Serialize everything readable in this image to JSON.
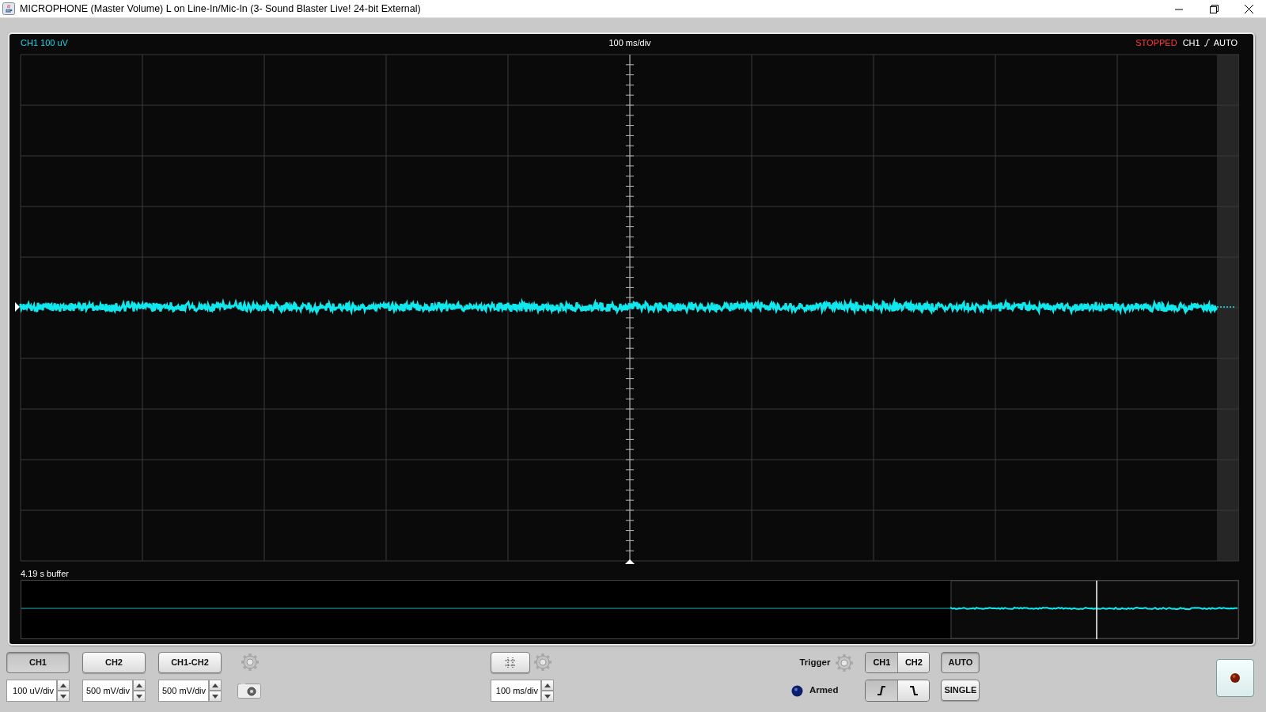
{
  "window": {
    "title": "MICROPHONE (Master Volume) L on Line-In/Mic-In (3- Sound Blaster Live! 24-bit External)"
  },
  "scope_header": {
    "channel_scale": "CH1 100 uV",
    "timebase": "100 ms/div",
    "status": "STOPPED",
    "trigger_channel": "CH1",
    "trigger_mode": "AUTO"
  },
  "buffer": {
    "label": "4.19 s buffer"
  },
  "channels": [
    {
      "label": "CH1",
      "selected": true,
      "scale": "100 uV/div"
    },
    {
      "label": "CH2",
      "selected": false,
      "scale": "500 mV/div"
    },
    {
      "label": "CH1-CH2",
      "selected": false,
      "scale": "500 mV/div"
    }
  ],
  "timebase": {
    "value": "100 ms/div"
  },
  "trigger": {
    "label": "Trigger",
    "armed_label": "Armed",
    "channels": [
      {
        "label": "CH1",
        "selected": true
      },
      {
        "label": "CH2",
        "selected": false
      }
    ],
    "slopes": [
      {
        "kind": "rising",
        "selected": true
      },
      {
        "kind": "falling",
        "selected": false
      }
    ],
    "modes": [
      {
        "label": "AUTO",
        "selected": true
      },
      {
        "label": "SINGLE",
        "selected": false
      }
    ]
  }
}
